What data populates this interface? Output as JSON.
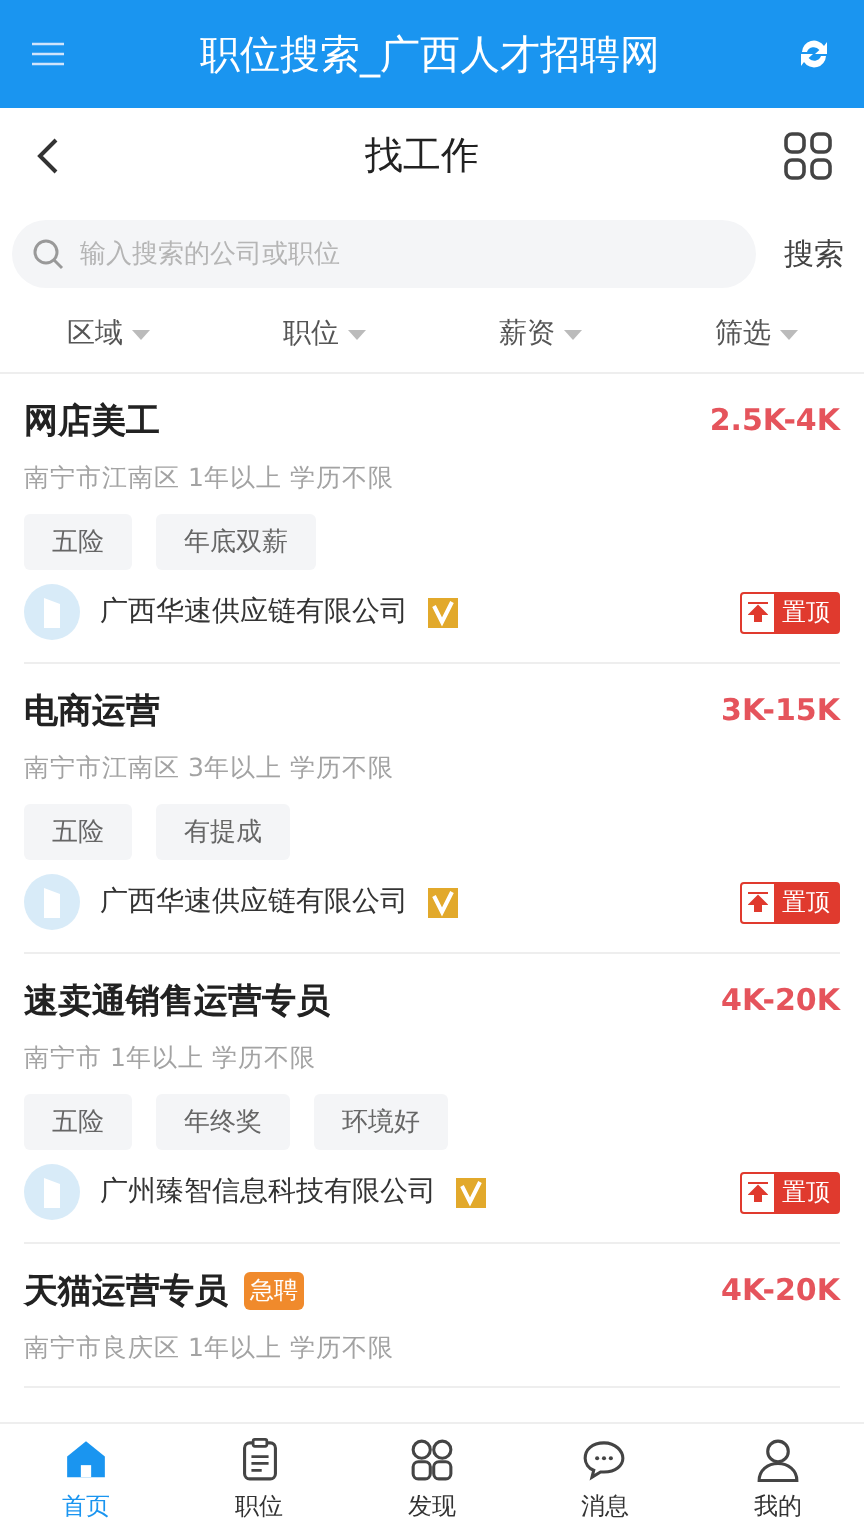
{
  "app_bar": {
    "title": "职位搜索_广西人才招聘网"
  },
  "nav_bar": {
    "title": "找工作"
  },
  "search": {
    "placeholder": "输入搜索的公司或职位",
    "button": "搜索"
  },
  "filters": [
    "区域",
    "职位",
    "薪资",
    "筛选"
  ],
  "jobs": [
    {
      "title": "网店美工",
      "salary": "2.5K-4K",
      "meta": "南宁市江南区 1年以上 学历不限",
      "tags": [
        "五险",
        "年底双薪"
      ],
      "company": "广西华速供应链有限公司",
      "verified": true,
      "pinned_badge": "置顶"
    },
    {
      "title": "电商运营",
      "salary": "3K-15K",
      "meta": "南宁市江南区 3年以上 学历不限",
      "tags": [
        "五险",
        "有提成"
      ],
      "company": "广西华速供应链有限公司",
      "verified": true,
      "pinned_badge": "置顶"
    },
    {
      "title": "速卖通销售运营专员",
      "salary": "4K-20K",
      "meta": "南宁市 1年以上 学历不限",
      "tags": [
        "五险",
        "年终奖",
        "环境好"
      ],
      "company": "广州臻智信息科技有限公司",
      "verified": true,
      "pinned_badge": "置顶"
    },
    {
      "title": "天猫运营专员",
      "urgent_badge": "急聘",
      "salary": "4K-20K",
      "meta": "南宁市良庆区 1年以上 学历不限"
    }
  ],
  "tab_bar": [
    {
      "label": "首页",
      "kind": "home",
      "selected": true
    },
    {
      "label": "职位",
      "kind": "clipboard",
      "selected": false
    },
    {
      "label": "发现",
      "kind": "grid",
      "selected": false
    },
    {
      "label": "消息",
      "kind": "chat",
      "selected": false
    },
    {
      "label": "我的",
      "kind": "person",
      "selected": false
    }
  ]
}
